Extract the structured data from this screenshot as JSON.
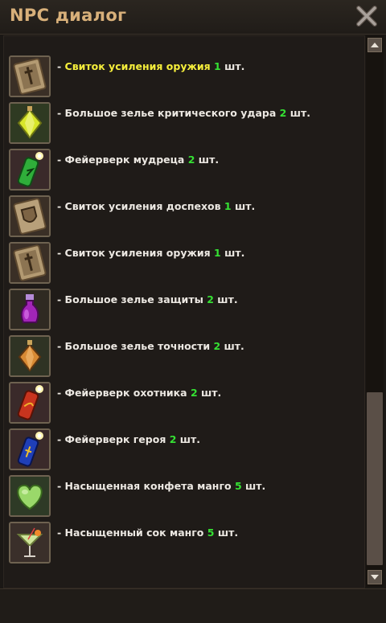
{
  "window": {
    "title": "NPC диалог",
    "close_icon": "close-icon"
  },
  "colors": {
    "title": "#d8b07a",
    "highlight": "#f5ee3b",
    "quantity": "#35e033",
    "text": "#ece8e2"
  },
  "items": [
    {
      "name": "Свиток усиления оружия",
      "qty": "1",
      "unit": "шт.",
      "icon": "weapon-scroll-icon",
      "prefix": "- "
    },
    {
      "name": "Большое зелье критического удара",
      "qty": "2",
      "unit": "шт.",
      "icon": "yellow-potion-icon",
      "prefix": "- "
    },
    {
      "name": "Фейерверк мудреца",
      "qty": "2",
      "unit": "шт.",
      "icon": "green-firework-icon",
      "prefix": "- "
    },
    {
      "name": "Свиток усиления доспехов",
      "qty": "1",
      "unit": "шт.",
      "icon": "armor-scroll-icon",
      "prefix": "- "
    },
    {
      "name": "Свиток усиления оружия",
      "qty": "1",
      "unit": "шт.",
      "icon": "weapon-scroll-icon",
      "prefix": "- "
    },
    {
      "name": "Большое зелье защиты",
      "qty": "2",
      "unit": "шт.",
      "icon": "purple-potion-icon",
      "prefix": "- "
    },
    {
      "name": "Большое зелье точности",
      "qty": "2",
      "unit": "шт.",
      "icon": "orange-potion-icon",
      "prefix": "- "
    },
    {
      "name": "Фейерверк охотника",
      "qty": "2",
      "unit": "шт.",
      "icon": "red-firework-icon",
      "prefix": "- "
    },
    {
      "name": "Фейерверк героя",
      "qty": "2",
      "unit": "шт.",
      "icon": "blue-firework-icon",
      "prefix": "- "
    },
    {
      "name": "Насыщенная конфета манго",
      "qty": "5",
      "unit": "шт.",
      "icon": "heart-candy-icon",
      "prefix": "- "
    },
    {
      "name": "Насыщенный сок манго",
      "qty": "5",
      "unit": "шт.",
      "icon": "cocktail-glass-icon",
      "prefix": "- "
    }
  ]
}
